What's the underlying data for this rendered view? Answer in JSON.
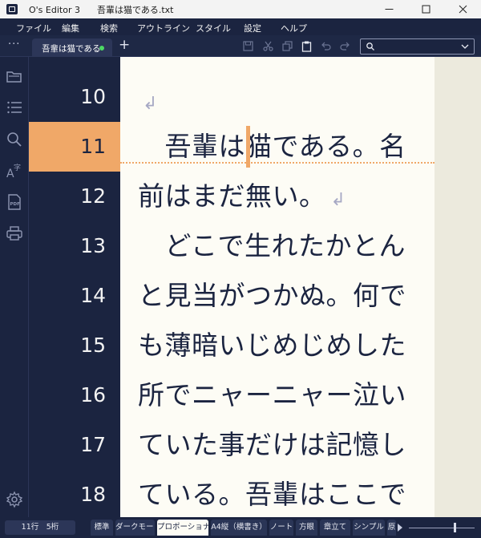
{
  "window": {
    "app_name": "O's Editor 3",
    "document_title": "吾輩は猫である.txt"
  },
  "menu": [
    "ファイル",
    "編集",
    "検索",
    "アウトライン",
    "スタイル",
    "設定",
    "ヘルプ"
  ],
  "tabs": {
    "more_label": "···",
    "active_tab": "吾輩は猫である",
    "add_label": "+",
    "unsaved_indicator_color": "#4cd964"
  },
  "toolbar": [
    "save-icon",
    "cut-icon",
    "copy-icon",
    "paste-icon",
    "undo-icon",
    "redo-icon"
  ],
  "search": {
    "value": "",
    "icon": "search-icon"
  },
  "sidebar": [
    "folder-icon",
    "outline-list-icon",
    "search-icon",
    "font-size-icon",
    "pdf-icon",
    "print-icon",
    "settings-icon"
  ],
  "editor": {
    "line_numbers": [
      "10",
      "11",
      "12",
      "13",
      "14",
      "15",
      "16",
      "17",
      "18"
    ],
    "current_line": "11",
    "lines": [
      {
        "text": "",
        "pilcrow": "↲"
      },
      {
        "text": "　吾輩は猫である。名",
        "pilcrow": ""
      },
      {
        "text": "前はまだ無い。",
        "pilcrow": "↲"
      },
      {
        "text": "　どこで生れたかとん",
        "pilcrow": ""
      },
      {
        "text": "と見当がつかぬ。何で",
        "pilcrow": ""
      },
      {
        "text": "も薄暗いじめじめした",
        "pilcrow": ""
      },
      {
        "text": "所でニャーニャー泣い",
        "pilcrow": ""
      },
      {
        "text": "ていた事だけは記憶し",
        "pilcrow": ""
      },
      {
        "text": "ている。吾輩はここで",
        "pilcrow": ""
      }
    ],
    "accent_color": "#f0a868"
  },
  "status": {
    "position": "11行　5桁",
    "styles": [
      "標準",
      "ダークモード",
      "プロポーショナル",
      "A4縦（横書き）",
      "ノート",
      "方眼",
      "章立て",
      "シンプル",
      "原"
    ],
    "active_style": "プロポーショナル"
  }
}
